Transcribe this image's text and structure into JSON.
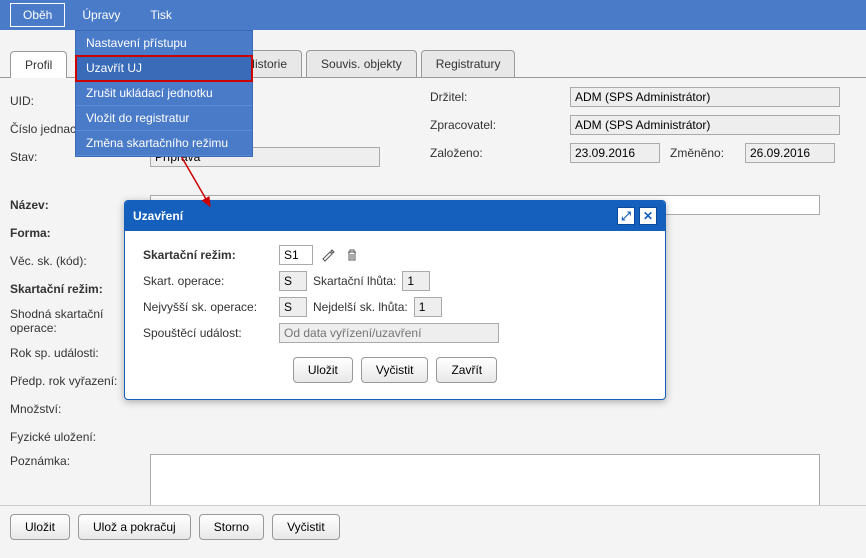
{
  "topbar": {
    "obeh": "Oběh",
    "upravy": "Úpravy",
    "tisk": "Tisk"
  },
  "dropdown": {
    "nastaveni": "Nastavení přístupu",
    "uzavrit": "Uzavřít UJ",
    "zrusit": "Zrušit ukládací jednotku",
    "vlozit": "Vložit do registratur",
    "zmena": "Změna skartačního režimu"
  },
  "tabs": {
    "profil": "Profil",
    "historie": "Historie",
    "souvis": "Souvis. objekty",
    "registratury": "Registratury"
  },
  "left": {
    "uid": "UID:",
    "cislo": "Číslo jednací:",
    "stav": "Stav:",
    "stav_val": "Příprava",
    "nazev": "Název:",
    "forma": "Forma:",
    "vecsk": "Věc. sk. (kód):",
    "skrezim": "Skartační režim:",
    "shodna": "Shodná skartační operace:",
    "roksp": "Rok sp. události:",
    "predp": "Předp. rok vyřazení:",
    "mnozstvi": "Množství:",
    "fyzicke": "Fyzické uložení:",
    "poznamka": "Poznámka:"
  },
  "right": {
    "drzitel": "Držitel:",
    "drzitel_val": "ADM (SPS Administrátor)",
    "zpracovatel": "Zpracovatel:",
    "zpracovatel_val": "ADM (SPS Administrátor)",
    "zalozeno": "Založeno:",
    "zalozeno_val": "23.09.2016",
    "zmeneno": "Změněno:",
    "zmeneno_val": "26.09.2016"
  },
  "modal": {
    "title": "Uzavření",
    "skrezim": "Skartační režim:",
    "skrezim_val": "S1",
    "skoperace": "Skart. operace:",
    "skoperace_val": "S",
    "sklhuta": "Skartační lhůta:",
    "sklhuta_val": "1",
    "nejvyssi": "Nejvyšší sk. operace:",
    "nejvyssi_val": "S",
    "nejdelsi": "Nejdelší sk. lhůta:",
    "nejdelsi_val": "1",
    "spousteci": "Spouštěcí událost:",
    "spousteci_placeholder": "Od data vyřízení/uzavření",
    "ulozit": "Uložit",
    "vycistit": "Vyčistit",
    "zavrit": "Zavřít"
  },
  "footer": {
    "ulozit": "Uložit",
    "ulozpokracuj": "Ulož a pokračuj",
    "storno": "Storno",
    "vycistit": "Vyčistit"
  }
}
